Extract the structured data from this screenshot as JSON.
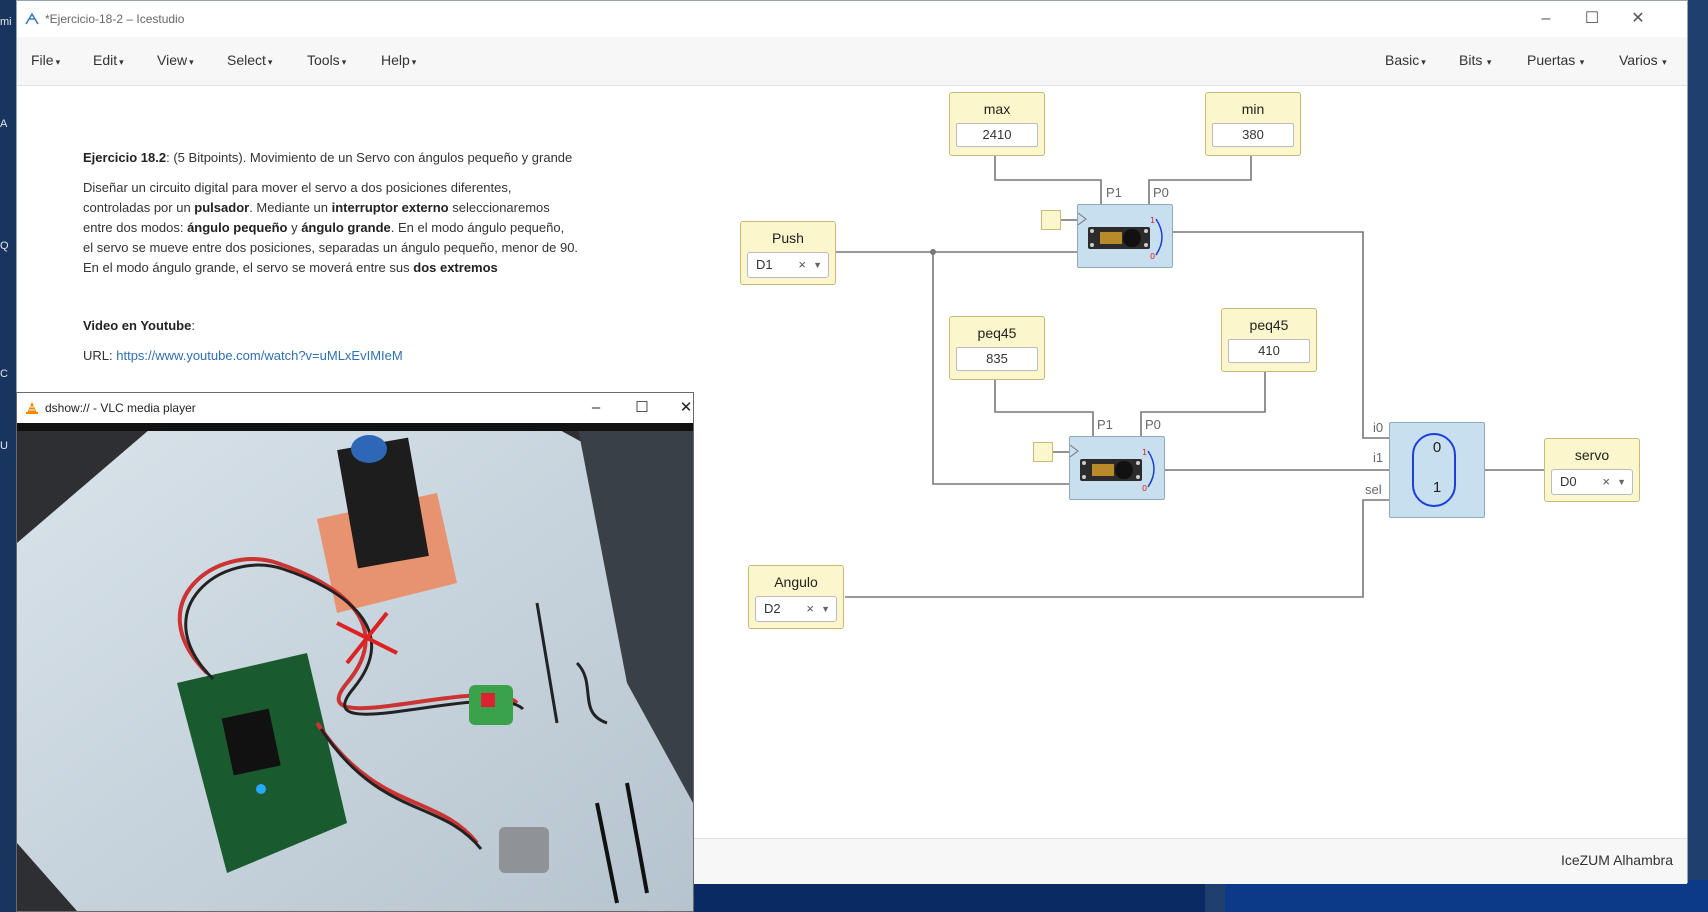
{
  "icestudio": {
    "title": "*Ejercicio-18-2 – Icestudio",
    "menu_left": [
      "File",
      "Edit",
      "View",
      "Select",
      "Tools",
      "Help"
    ],
    "menu_right": [
      "Basic",
      "Bits",
      "Puertas",
      "Varios"
    ],
    "footer_brand": "IceZUM Alhambra",
    "info": {
      "heading_bold": "Ejercicio 18.2",
      "heading_rest": ": (5 Bitpoints). Movimiento de un Servo con ángulos pequeño y grande",
      "p1": "Diseñar un circuito digital para mover el servo a dos posiciones diferentes,",
      "p2a": "controladas por un ",
      "p2b": "pulsador",
      "p2c": ". Mediante un ",
      "p2d": "interruptor externo",
      "p2e": " seleccionaremos",
      "p3a": "entre dos modos: ",
      "p3b": "ángulo pequeño",
      "p3c": " y ",
      "p3d": "ángulo grande",
      "p3e": ". En el modo ángulo pequeño,",
      "p4": "el servo se mueve entre dos posiciones, separadas un ángulo pequeño, menor de 90.",
      "p5a": "En el modo ángulo grande, el servo se moverá entre sus ",
      "p5b": "dos extremos",
      "video_bold": "Video en Youtube",
      "video_colon": ":",
      "url_label": "URL: ",
      "url": "https://www.youtube.com/watch?v=uMLxEvIMIeM"
    },
    "blocks": {
      "max": {
        "label": "max",
        "value": "2410"
      },
      "min": {
        "label": "min",
        "value": "380"
      },
      "peq45a": {
        "label": "peq45",
        "value": "835"
      },
      "peq45b": {
        "label": "peq45",
        "value": "410"
      },
      "push": {
        "label": "Push",
        "pin": "D1"
      },
      "angulo": {
        "label": "Angulo",
        "pin": "D2"
      },
      "servo": {
        "label": "servo",
        "pin": "D0"
      }
    },
    "pins": {
      "p1": "P1",
      "p0": "P0",
      "i0": "i0",
      "i1": "i1",
      "sel": "sel"
    },
    "mux": {
      "top": "0",
      "bottom": "1"
    },
    "select_clear": "×"
  },
  "vlc": {
    "title": "dshow:// - VLC media player"
  },
  "colors": {
    "accent": "#1c3fd8",
    "block_yellow": "#fcf6cc",
    "block_blue": "#c7dfee"
  }
}
